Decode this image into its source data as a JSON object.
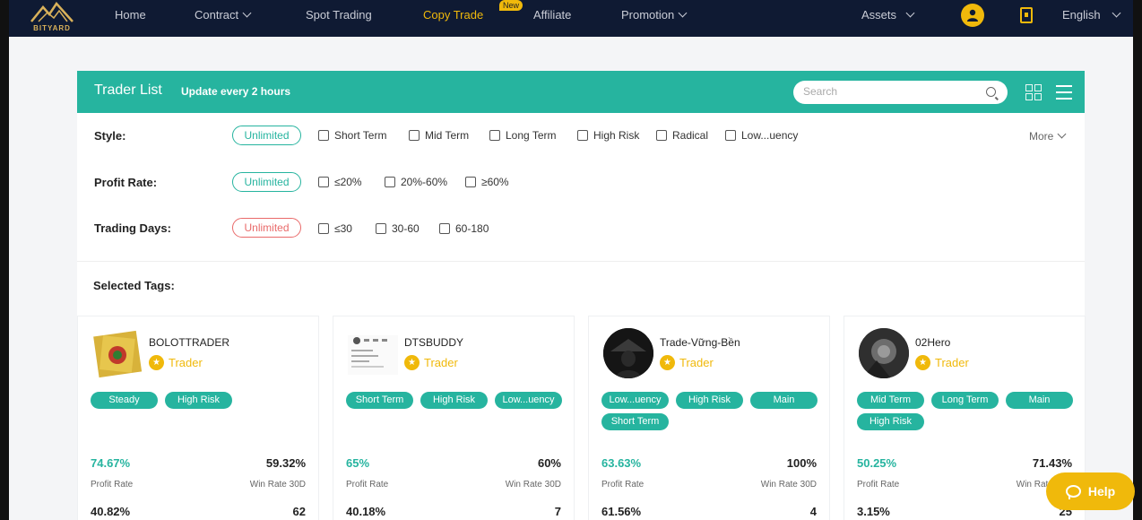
{
  "nav": {
    "logo_text": "BITYARD",
    "home": "Home",
    "contract": "Contract",
    "spot": "Spot Trading",
    "copy_trade": "Copy Trade",
    "new_badge": "New",
    "affiliate": "Affiliate",
    "promotion": "Promotion",
    "assets": "Assets",
    "language": "English",
    "active_color": "#f0b90b"
  },
  "panel": {
    "title": "Trader List",
    "subtitle": "Update every 2 hours",
    "search_placeholder": "Search",
    "accent": "#26b49f"
  },
  "filters": {
    "style": {
      "label": "Style:",
      "selected": "Unlimited",
      "options": [
        "Short Term",
        "Mid Term",
        "Long Term",
        "High Risk",
        "Radical",
        "Low...uency"
      ],
      "more": "More"
    },
    "profit": {
      "label": "Profit Rate:",
      "selected": "Unlimited",
      "options": [
        "≤20%",
        "20%-60%",
        "≥60%"
      ]
    },
    "days": {
      "label": "Trading Days:",
      "selected": "Unlimited",
      "options": [
        "≤30",
        "30-60",
        "60-180"
      ]
    }
  },
  "selected_tags_label": "Selected Tags:",
  "traders": [
    {
      "name": "BOLOTTRADER",
      "role": "Trader",
      "tags": [
        "Steady",
        "High Risk"
      ],
      "profit_rate": "74.67%",
      "profit_label": "Profit Rate",
      "win_rate": "59.32%",
      "win_label": "Win Rate 30D",
      "stat3": "40.82%",
      "stat4": "62"
    },
    {
      "name": "DTSBUDDY",
      "role": "Trader",
      "tags": [
        "Short Term",
        "High Risk",
        "Low...uency"
      ],
      "profit_rate": "65%",
      "profit_label": "Profit Rate",
      "win_rate": "60%",
      "win_label": "Win Rate 30D",
      "stat3": "40.18%",
      "stat4": "7"
    },
    {
      "name": "Trade-Vững-Bền",
      "role": "Trader",
      "tags": [
        "Low...uency",
        "High Risk",
        "Main",
        "Short Term"
      ],
      "profit_rate": "63.63%",
      "profit_label": "Profit Rate",
      "win_rate": "100%",
      "win_label": "Win Rate 30D",
      "stat3": "61.56%",
      "stat4": "4"
    },
    {
      "name": "02Hero",
      "role": "Trader",
      "tags": [
        "Mid Term",
        "Long Term",
        "Main",
        "High Risk"
      ],
      "profit_rate": "50.25%",
      "profit_label": "Profit Rate",
      "win_rate": "71.43%",
      "win_label": "Win Rate 30D",
      "stat3": "3.15%",
      "stat4": "25"
    }
  ],
  "help": {
    "label": "Help"
  }
}
